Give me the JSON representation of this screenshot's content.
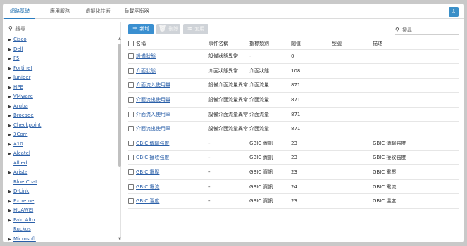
{
  "tabs": [
    {
      "label": "網路基礎",
      "active": true
    },
    {
      "label": "應用服務",
      "active": false
    },
    {
      "label": "虛擬化技術",
      "active": false
    },
    {
      "label": "負載平衡器",
      "active": false
    }
  ],
  "sidebar": {
    "search_placeholder": "搜尋",
    "items": [
      {
        "label": "Cisco",
        "expandable": true
      },
      {
        "label": "Dell",
        "expandable": true
      },
      {
        "label": "F5",
        "expandable": true
      },
      {
        "label": "Fortinet",
        "expandable": true
      },
      {
        "label": "Juniper",
        "expandable": true
      },
      {
        "label": "HPE",
        "expandable": true
      },
      {
        "label": "VMware",
        "expandable": true
      },
      {
        "label": "Aruba",
        "expandable": true
      },
      {
        "label": "Brocade",
        "expandable": true
      },
      {
        "label": "Checkpoint",
        "expandable": true
      },
      {
        "label": "3Com",
        "expandable": true
      },
      {
        "label": "A10",
        "expandable": true
      },
      {
        "label": "Alcatel",
        "expandable": true
      },
      {
        "label": "Allied",
        "expandable": false
      },
      {
        "label": "Arista",
        "expandable": true
      },
      {
        "label": "Blue Coat",
        "expandable": false
      },
      {
        "label": "D-Link",
        "expandable": true
      },
      {
        "label": "Extreme",
        "expandable": true
      },
      {
        "label": "HUAWEI",
        "expandable": true
      },
      {
        "label": "Palo Alto",
        "expandable": true
      },
      {
        "label": "Ruckus",
        "expandable": false
      },
      {
        "label": "Microsoft",
        "expandable": true
      }
    ]
  },
  "toolbar": {
    "add_label": "新增",
    "delete_label": "刪除",
    "apply_label": "套用"
  },
  "main_search": {
    "placeholder": "搜尋"
  },
  "table": {
    "headers": [
      "名稱",
      "事件名稱",
      "指標類別",
      "閾值",
      "型號",
      "描述"
    ],
    "rows": [
      [
        "設備狀態",
        "設備狀態異常",
        "-",
        "0",
        "",
        ""
      ],
      [
        "介面狀態",
        "介面狀態異常",
        "介面狀態",
        "108",
        "",
        ""
      ],
      [
        "介面流入使用量",
        "設備介面流量異常",
        "介面流量",
        "871",
        "",
        ""
      ],
      [
        "介面流出使用量",
        "設備介面流量異常",
        "介面流量",
        "871",
        "",
        ""
      ],
      [
        "介面流入使用率",
        "設備介面流量異常",
        "介面流量",
        "871",
        "",
        ""
      ],
      [
        "介面流出使用率",
        "設備介面流量異常",
        "介面流量",
        "871",
        "",
        ""
      ],
      [
        "GBIC 傳輸強度",
        "-",
        "GBIC 資訊",
        "23",
        "",
        "GBIC 傳輸強度"
      ],
      [
        "GBIC 接收強度",
        "-",
        "GBIC 資訊",
        "23",
        "",
        "GBIC 接收強度"
      ],
      [
        "GBIC 電壓",
        "-",
        "GBIC 資訊",
        "23",
        "",
        "GBIC 電壓"
      ],
      [
        "GBIC 電流",
        "-",
        "GBIC 資訊",
        "24",
        "",
        "GBIC 電流"
      ],
      [
        "GBIC 溫度",
        "-",
        "GBIC 資訊",
        "23",
        "",
        "GBIC 溫度"
      ]
    ]
  },
  "colors": {
    "accent": "#3a8fd0",
    "link": "#2a5fa8",
    "active_tab": "#1e6fb0"
  }
}
